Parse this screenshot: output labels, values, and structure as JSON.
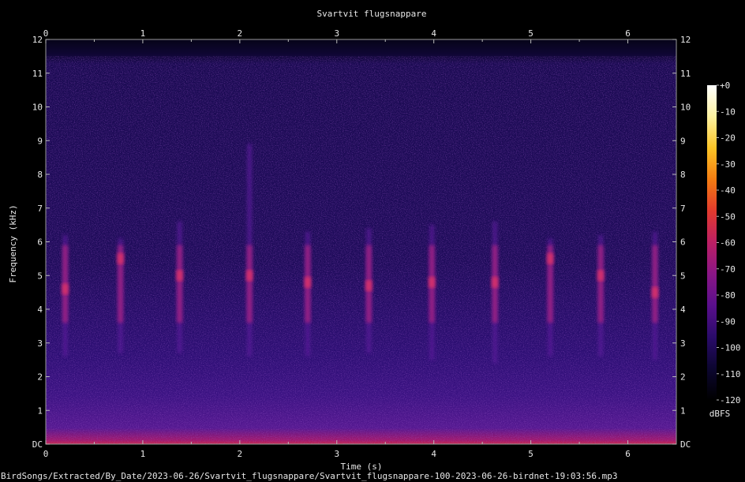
{
  "chart_data": {
    "type": "heatmap",
    "title": "Svartvit flugsnappare",
    "xlabel": "Time (s)",
    "ylabel": "Frequency (kHz)",
    "xlim": [
      0,
      6.5
    ],
    "ylim": [
      0,
      12
    ],
    "x_ticks": [
      "0",
      "1",
      "2",
      "3",
      "4",
      "5",
      "6"
    ],
    "y_ticks": [
      "DC",
      "1",
      "2",
      "3",
      "4",
      "5",
      "6",
      "7",
      "8",
      "9",
      "10",
      "11",
      "12"
    ],
    "colorbar": {
      "label": "dBFS",
      "range": [
        -120,
        0
      ],
      "ticks": [
        "+0",
        "-10",
        "-20",
        "-30",
        "-40",
        "-50",
        "-60",
        "-70",
        "-80",
        "-90",
        "-100",
        "-110",
        "-120"
      ],
      "colors": [
        "#000000",
        "#0c0630",
        "#2a0b6a",
        "#5a0f8c",
        "#8a1686",
        "#bc1f64",
        "#e23a2e",
        "#f47c12",
        "#fbc426",
        "#fcf1a0",
        "#ffffff"
      ]
    },
    "background_colors": [
      "#0e0632",
      "#1a0a52",
      "#2c0e74",
      "#3a1282",
      "#541890"
    ],
    "noise_floor_kHz": 11.5,
    "calls": [
      {
        "t": 0.2,
        "f_low": 2.6,
        "f_high": 6.2,
        "peak_kHz": 4.6
      },
      {
        "t": 0.77,
        "f_low": 2.7,
        "f_high": 6.1,
        "peak_kHz": 5.5
      },
      {
        "t": 1.38,
        "f_low": 2.7,
        "f_high": 6.6,
        "peak_kHz": 5.0
      },
      {
        "t": 2.1,
        "f_low": 2.6,
        "f_high": 8.9,
        "peak_kHz": 5.0
      },
      {
        "t": 2.7,
        "f_low": 2.6,
        "f_high": 6.3,
        "peak_kHz": 4.8
      },
      {
        "t": 3.33,
        "f_low": 2.7,
        "f_high": 6.4,
        "peak_kHz": 4.7
      },
      {
        "t": 3.98,
        "f_low": 2.5,
        "f_high": 6.5,
        "peak_kHz": 4.8
      },
      {
        "t": 4.63,
        "f_low": 2.4,
        "f_high": 6.6,
        "peak_kHz": 4.8
      },
      {
        "t": 5.2,
        "f_low": 2.6,
        "f_high": 6.1,
        "peak_kHz": 5.5
      },
      {
        "t": 5.72,
        "f_low": 2.6,
        "f_high": 6.2,
        "peak_kHz": 5.0
      },
      {
        "t": 6.28,
        "f_low": 2.5,
        "f_high": 6.3,
        "peak_kHz": 4.5
      }
    ]
  },
  "footer": {
    "path": "BirdSongs/Extracted/By_Date/2023-06-26/Svartvit_flugsnappare/Svartvit_flugsnappare-100-2023-06-26-birdnet-19:03:56.mp3"
  }
}
